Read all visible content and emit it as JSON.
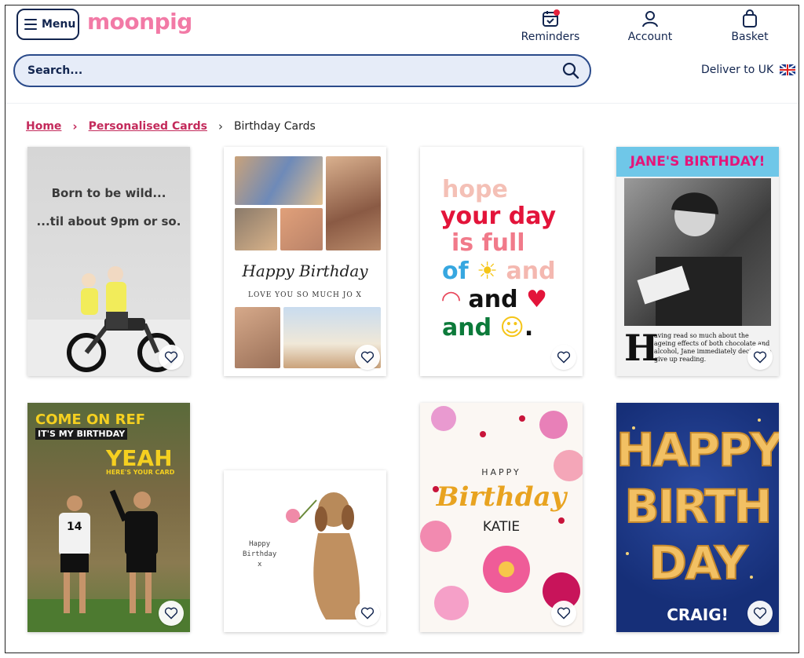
{
  "header": {
    "menu_label": "Menu",
    "logo_text": "moonpig",
    "nav": {
      "reminders": "Reminders",
      "account": "Account",
      "basket": "Basket"
    },
    "reminders_badge_color": "#e5213c"
  },
  "search": {
    "placeholder": "Search..."
  },
  "deliver": {
    "label": "Deliver to UK"
  },
  "breadcrumb": {
    "home": "Home",
    "personalised": "Personalised Cards",
    "current": "Birthday Cards"
  },
  "cards": {
    "card1": {
      "line1": "Born to be wild...",
      "line2": "...til about 9pm or so."
    },
    "card2": {
      "script": "Happy Birthday",
      "small": "LOVE YOU SO MUCH JO X"
    },
    "card3": {
      "l1": "hope",
      "l2": "your day",
      "l3": "is full",
      "l4": "of",
      "l5": "and",
      "l6": "and",
      "l7": "and"
    },
    "card4": {
      "banner": "JANE'S BIRTHDAY!",
      "initial": "H",
      "story": "aving read so much about the ageing effects of both chocolate and alcohol, Jane immediately decided to give up reading."
    },
    "card5": {
      "t1": "COME ON REF",
      "t2": "IT'S MY BIRTHDAY",
      "t3": "YEAH",
      "t4": "HERE'S YOUR CARD",
      "shirt": "14"
    },
    "card6": {
      "l1": "Happy",
      "l2": "Birthday",
      "l3": "x"
    },
    "card7": {
      "happy": "HAPPY",
      "bday": "Birthday",
      "name": "KATIE"
    },
    "card8": {
      "l1": "HAPPY",
      "l2": "BIRTH",
      "l3": "DAY",
      "name": "CRAIG!"
    }
  },
  "colors": {
    "navy": "#12254f",
    "brand_pink": "#f27aa6",
    "link_red": "#c32a5b",
    "search_bg": "#e6ecf8"
  }
}
